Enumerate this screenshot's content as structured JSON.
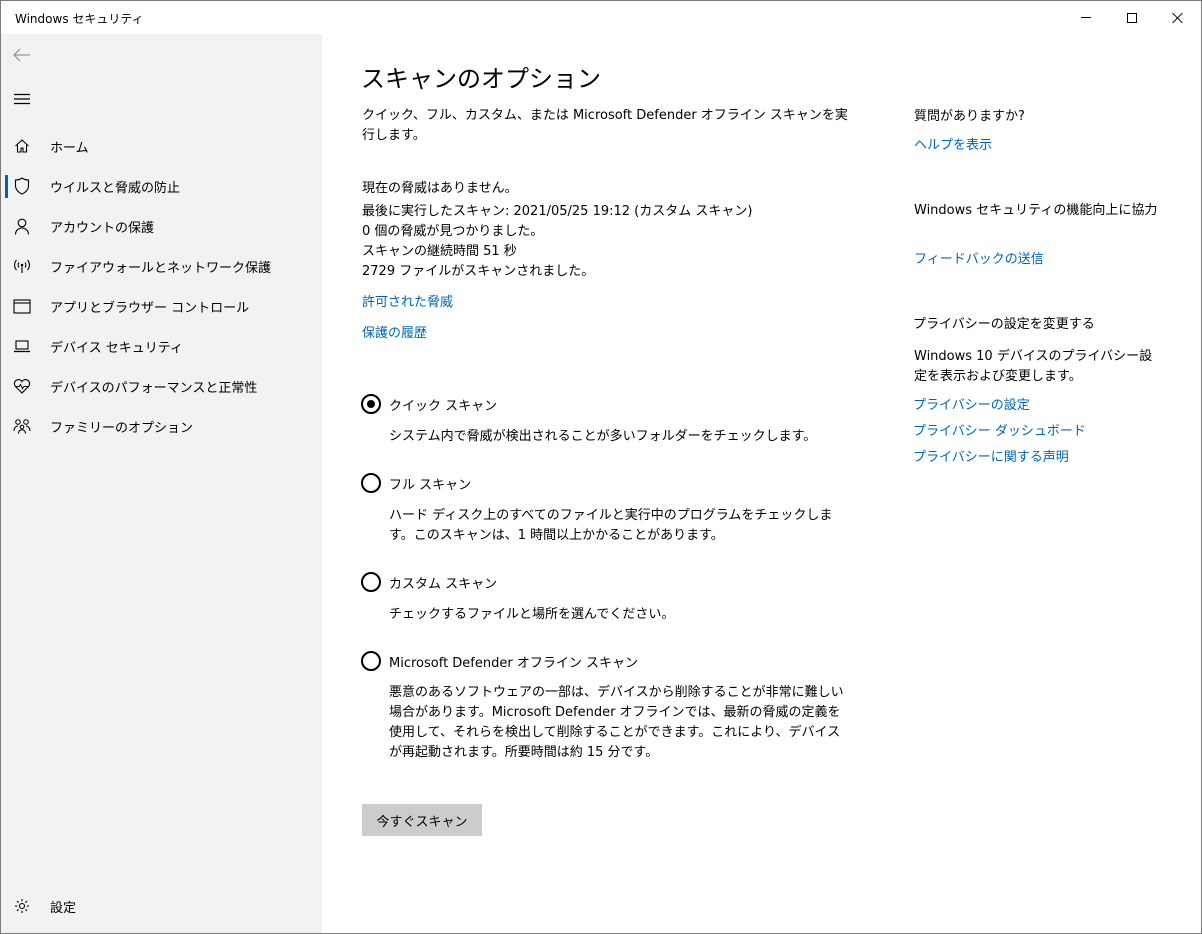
{
  "window": {
    "title": "Windows セキュリティ"
  },
  "sidebar": {
    "items": [
      {
        "label": "ホーム",
        "icon": "home-icon"
      },
      {
        "label": "ウイルスと脅威の防止",
        "icon": "shield-icon",
        "active": true
      },
      {
        "label": "アカウントの保護",
        "icon": "person-icon"
      },
      {
        "label": "ファイアウォールとネットワーク保護",
        "icon": "wireless-icon"
      },
      {
        "label": "アプリとブラウザー コントロール",
        "icon": "app-window-icon"
      },
      {
        "label": "デバイス セキュリティ",
        "icon": "laptop-icon"
      },
      {
        "label": "デバイスのパフォーマンスと正常性",
        "icon": "heart-pulse-icon"
      },
      {
        "label": "ファミリーのオプション",
        "icon": "family-icon"
      }
    ],
    "settings_label": "設定"
  },
  "main": {
    "title": "スキャンのオプション",
    "intro": "クイック、フル、カスタム、または Microsoft Defender オフライン スキャンを実行します。",
    "status": {
      "no_threats": "現在の脅威はありません。",
      "last_scan": "最後に実行したスキャン: 2021/05/25 19:12 (カスタム スキャン)",
      "threats_found": "0 個の脅威が見つかりました。",
      "duration": "スキャンの継続時間 51 秒",
      "files_scanned": "2729 ファイルがスキャンされました。"
    },
    "links": {
      "allowed_threats": "許可された脅威",
      "protection_history": "保護の履歴"
    },
    "options": [
      {
        "label": "クイック スキャン",
        "desc": "システム内で脅威が検出されることが多いフォルダーをチェックします。",
        "checked": true
      },
      {
        "label": "フル スキャン",
        "desc": "ハード ディスク上のすべてのファイルと実行中のプログラムをチェックします。このスキャンは、1 時間以上かかることがあります。",
        "checked": false
      },
      {
        "label": "カスタム スキャン",
        "desc": "チェックするファイルと場所を選んでください。",
        "checked": false
      },
      {
        "label": "Microsoft Defender オフライン スキャン",
        "desc": "悪意のあるソフトウェアの一部は、デバイスから削除することが非常に難しい場合があります。Microsoft Defender オフラインでは、最新の脅威の定義を使用して、それらを検出して削除することができます。これにより、デバイスが再起動されます。所要時間は約 15 分です。",
        "checked": false
      }
    ],
    "scan_button": "今すぐスキャン"
  },
  "right": {
    "question_heading": "質問がありますか?",
    "help_link": "ヘルプを表示",
    "improve_heading": "Windows セキュリティの機能向上に協力",
    "feedback_link": "フィードバックの送信",
    "privacy_heading": "プライバシーの設定を変更する",
    "privacy_text": "Windows 10 デバイスのプライバシー設定を表示および変更します。",
    "privacy_links": [
      "プライバシーの設定",
      "プライバシー ダッシュボード",
      "プライバシーに関する声明"
    ]
  }
}
